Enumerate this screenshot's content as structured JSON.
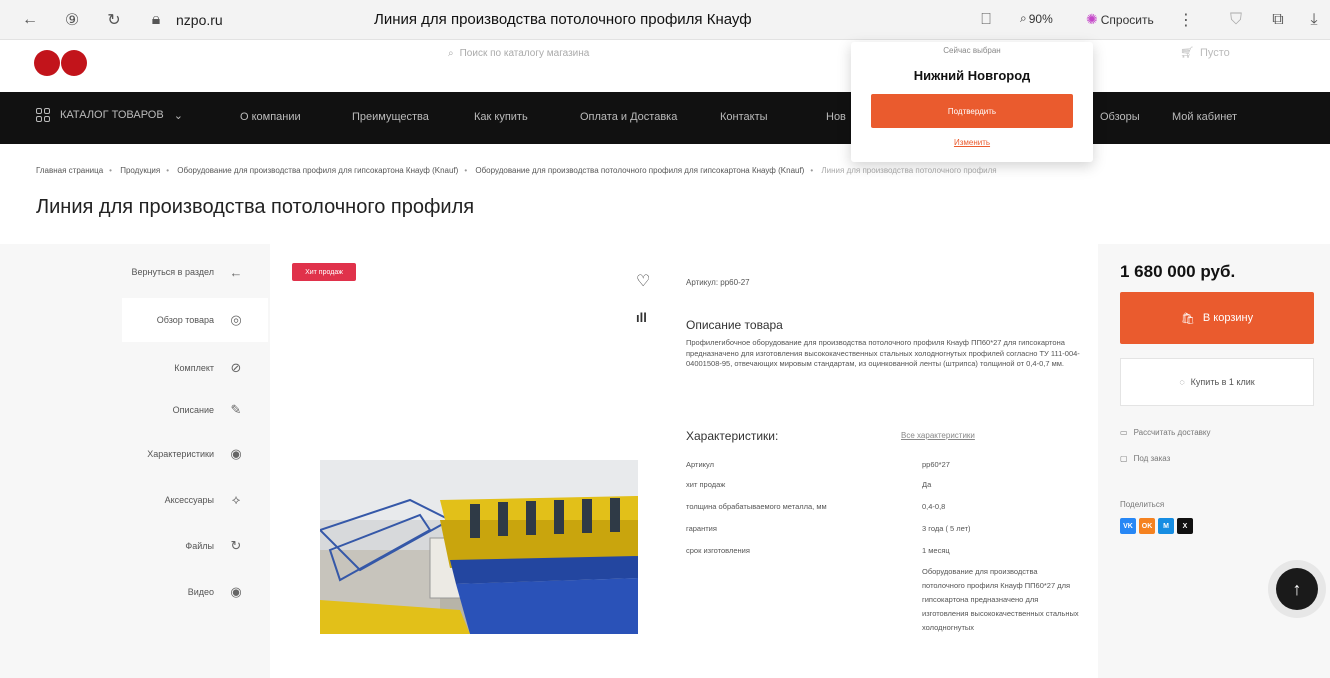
{
  "browser": {
    "url": "nzpo.ru",
    "tab_title": "Линия для производства потолочного профиля Кнауф",
    "zoom": "90%",
    "ask_label": "Спросить"
  },
  "header": {
    "search_placeholder": "Поиск по каталогу магазина",
    "cart_label": "Пусто"
  },
  "nav": {
    "catalog": "КАТАЛОГ ТОВАРОВ",
    "items": [
      "О компании",
      "Преимущества",
      "Как купить",
      "Оплата и Доставка",
      "Контакты",
      "Нов",
      "Обзоры",
      "Мой кабинет"
    ]
  },
  "breadcrumb": [
    "Главная страница",
    "Продукция",
    "Оборудование для производства профиля для гипсокартона Кнауф (Knauf)",
    "Оборудование для производства потолочного профиля для гипсокартона Кнауф (Knauf)",
    "Линия для производства потолочного профиля"
  ],
  "page_title": "Линия для производства потолочного профиля",
  "side_nav": [
    {
      "label": "Вернуться в раздел",
      "icon": "←"
    },
    {
      "label": "Обзор товара",
      "icon": "◎"
    },
    {
      "label": "Комплект",
      "icon": "⊘"
    },
    {
      "label": "Описание",
      "icon": "✎"
    },
    {
      "label": "Характеристики",
      "icon": "◉"
    },
    {
      "label": "Аксессуары",
      "icon": "⟡"
    },
    {
      "label": "Файлы",
      "icon": "↻"
    },
    {
      "label": "Видео",
      "icon": "◉"
    }
  ],
  "gallery": {
    "badge": "Хит продаж"
  },
  "details": {
    "article": "Артикул: pp60-27",
    "desc_title": "Описание товара",
    "desc_text": "Профилегибочное оборудование для производства потолочного профиля Кнауф ПП60*27 для гипсокартона предназначено для изготовления высококачественных стальных холодногнутых профилей согласно ТУ 111-004-04001508-95, отвечающих мировым стандартам, из оцинкованной ленты (штрипса) толщиной от 0,4-0,7 мм.",
    "char_title": "Характеристики:",
    "char_all": "Все характеристики",
    "chars": [
      {
        "k": "Артикул",
        "v": "pp60*27"
      },
      {
        "k": "хит продаж",
        "v": "Да"
      },
      {
        "k": "толщина обрабатываемого металла, мм",
        "v": "0,4-0,8"
      },
      {
        "k": "гарантия",
        "v": "3 года ( 5 лет)"
      },
      {
        "k": "срок изготовления",
        "v": "1 месяц"
      }
    ],
    "char_long": "Оборудование для производства потолочного профиля Кнауф ПП60*27 для гипсокартона предназначено для изготовления высококачественных стальных холодногнутых"
  },
  "buy": {
    "price": "1 680 000 руб.",
    "cart_button": "В корзину",
    "oneclick_button": "Купить в 1 клик",
    "calc_delivery": "Рассчитать доставку",
    "preorder": "Под заказ",
    "share_label": "Поделиться",
    "share": [
      {
        "text": "VK",
        "color": "#2787f5"
      },
      {
        "text": "OK",
        "color": "#f58220"
      },
      {
        "text": "M",
        "color": "#168de2"
      },
      {
        "text": "X",
        "color": "#111111"
      }
    ]
  },
  "city_popup": {
    "now": "Сейчас выбран",
    "city": "Нижний Новгород",
    "confirm": "Подтвердить",
    "change": "Изменить"
  }
}
